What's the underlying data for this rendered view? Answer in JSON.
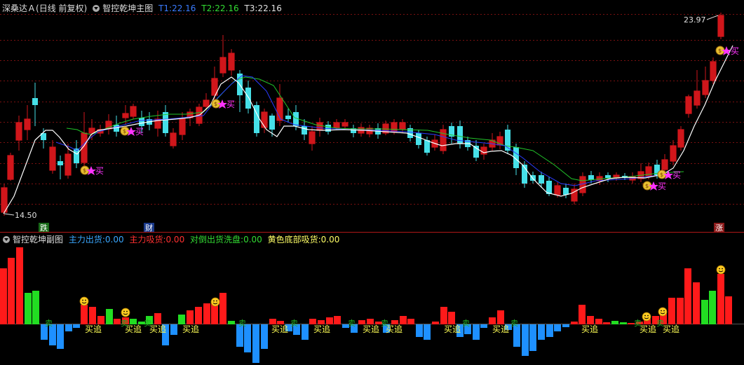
{
  "main_header": {
    "stock_name": "深桑达Ａ",
    "period_mode": "(日线 前复权)",
    "indicator_name": "智控乾坤主图",
    "t1_label": "T1:",
    "t1_value": "22.16",
    "t2_label": "T2:",
    "t2_value": "22.16",
    "t3_label": "T3:",
    "t3_value": "22.16",
    "colors": {
      "t1": "#3a7bff",
      "t2": "#33dd33",
      "t3": "#e0e0e0"
    }
  },
  "main_chart": {
    "high_label": "23.97",
    "low_label": "14.50",
    "buy_label": "买",
    "markers": [
      "跌",
      "财",
      "涨"
    ],
    "colors": {
      "up": "#d0161b",
      "down": "#46e0e8",
      "white_line": "#ffffff",
      "green_line": "#22c42a",
      "blue_line": "#2a3cff",
      "grid": "#7a1010",
      "buy_text": "#ff33ff"
    }
  },
  "sub_header": {
    "indicator_name": "智控乾坤副图",
    "l1_label": "主力出货:",
    "l1_value": "0.00",
    "l2_label": "主力吸货:",
    "l2_value": "0.00",
    "l3_label": "对倒出货洗盘:",
    "l3_value": "0.00",
    "l4_label": "黄色底部吸货:",
    "l4_value": "0.00",
    "colors": {
      "l1": "#3aa7ff",
      "l2": "#ff3030",
      "l3": "#33dd33",
      "l4": "#ffff66"
    }
  },
  "sub_chart": {
    "buy_add_label": "买追",
    "sell_label": "卖",
    "colors": {
      "red": "#ff1a1a",
      "blue": "#1e90ff",
      "green": "#22dd22",
      "text": "#ffff55",
      "sell": "#22aa22"
    }
  }
}
